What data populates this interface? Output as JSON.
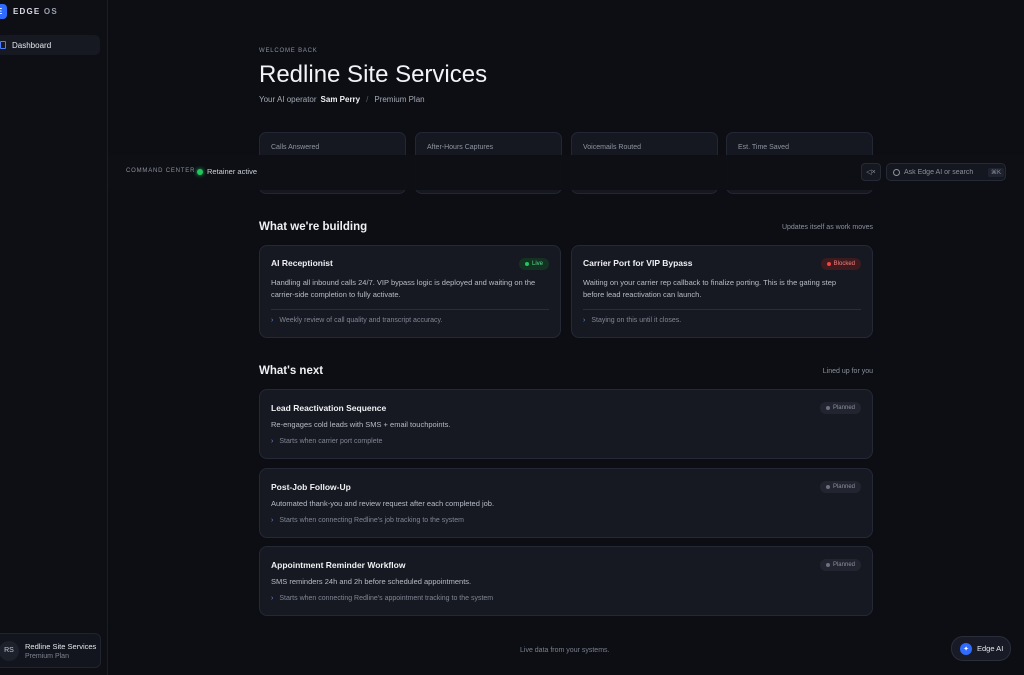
{
  "brand": {
    "logo_glyph": "E",
    "name": "EDGE",
    "name_suffix": " OS"
  },
  "sidebar": {
    "items": [
      {
        "label": "Dashboard"
      }
    ]
  },
  "account": {
    "initials": "RS",
    "name": "Redline Site Services",
    "plan": "Premium Plan"
  },
  "header": {
    "eyebrow": "WELCOME BACK",
    "title": "Redline Site Services",
    "operator_prefix": "Your AI operator",
    "operator_name": "Sam Perry",
    "separator": "/",
    "plan": "Premium Plan"
  },
  "stats": [
    {
      "label": "Calls Answered"
    },
    {
      "label": "After-Hours Captures"
    },
    {
      "label": "Voicemails Routed"
    },
    {
      "label": "Est. Time Saved"
    }
  ],
  "command_bar": {
    "label": "COMMAND CENTER",
    "status_label": "Retainer active",
    "mute_glyph": "◁×",
    "search_placeholder": "Ask Edge AI or search",
    "shortcut": "⌘K"
  },
  "building": {
    "title": "What we're building",
    "meta": "Updates itself as work moves",
    "cards": [
      {
        "title": "AI Receptionist",
        "badge": "Live",
        "desc_line1": "Handling all inbound calls 24/7. VIP bypass logic is deployed and waiting on the",
        "desc_line2": "carrier-side completion to fully activate.",
        "foot": "Weekly review of call quality and transcript accuracy."
      },
      {
        "title": "Carrier Port for VIP Bypass",
        "badge": "Blocked",
        "desc_line1": "Waiting on your carrier rep callback to finalize porting. This is the gating step",
        "desc_line2": "before lead reactivation can launch.",
        "foot": "Staying on this until it closes."
      }
    ]
  },
  "next": {
    "title": "What's next",
    "meta": "Lined up for you",
    "cards": [
      {
        "title": "Lead Reactivation Sequence",
        "badge": "Planned",
        "desc": "Re-engages cold leads with SMS + email touchpoints.",
        "foot": "Starts when carrier port complete"
      },
      {
        "title": "Post-Job Follow-Up",
        "badge": "Planned",
        "desc": "Automated thank-you and review request after each completed job.",
        "foot": "Starts when connecting Redline's job tracking to the system"
      },
      {
        "title": "Appointment Reminder Workflow",
        "badge": "Planned",
        "desc": "SMS reminders 24h and 2h before scheduled appointments.",
        "foot": "Starts when connecting Redline's appointment tracking to the system"
      }
    ]
  },
  "footer": {
    "note": "Live data from your systems."
  },
  "assistant": {
    "glyph": "✦",
    "label": "Edge AI"
  },
  "colors": {
    "accent": "#2f6bff",
    "live": "#22c55e",
    "blocked": "#ef4444",
    "background": "#0c0e14"
  }
}
